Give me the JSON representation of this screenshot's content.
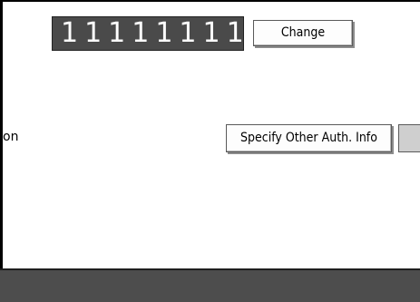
{
  "code_display": {
    "value": "11111111"
  },
  "buttons": {
    "change_label": "Change",
    "specify_label": "Specify Other Auth. Info"
  },
  "side_label": {
    "text": "on"
  },
  "colors": {
    "code_display_bg": "#4a4a4a",
    "bottom_bar_bg": "#4d4d4d",
    "button_bg": "#fdfdfd",
    "partial_button_bg": "#cfcfcf"
  }
}
